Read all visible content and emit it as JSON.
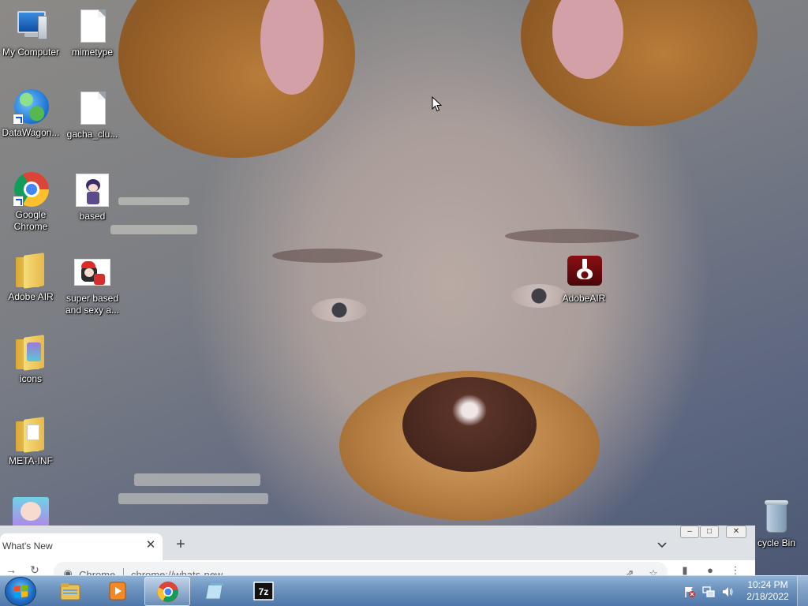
{
  "desktop": {
    "icons": [
      {
        "label": "My Computer"
      },
      {
        "label": "mimetype"
      },
      {
        "label": "DataWagon..."
      },
      {
        "label": "gacha_clu..."
      },
      {
        "label": "Google Chrome"
      },
      {
        "label": "based"
      },
      {
        "label": "Adobe AIR"
      },
      {
        "label": "super based and sexy a..."
      },
      {
        "label": "icons"
      },
      {
        "label": "META-INF"
      },
      {
        "label": "AdobeAIR"
      },
      {
        "label": "cycle Bin"
      }
    ]
  },
  "browser": {
    "tab": {
      "title": "What's New"
    },
    "newtab_label": "+",
    "address_chip": "Chrome",
    "address_url": "chrome://whats-new"
  },
  "taskbar": {
    "pinned": [
      {
        "icon": "file-explorer-icon"
      },
      {
        "icon": "media-player-icon"
      },
      {
        "icon": "chrome-icon",
        "active": true
      },
      {
        "icon": "notepad-icon"
      },
      {
        "icon": "7zip-icon",
        "label": "7z"
      }
    ],
    "clock": {
      "time": "10:24 PM",
      "date": "2/18/2022"
    }
  }
}
